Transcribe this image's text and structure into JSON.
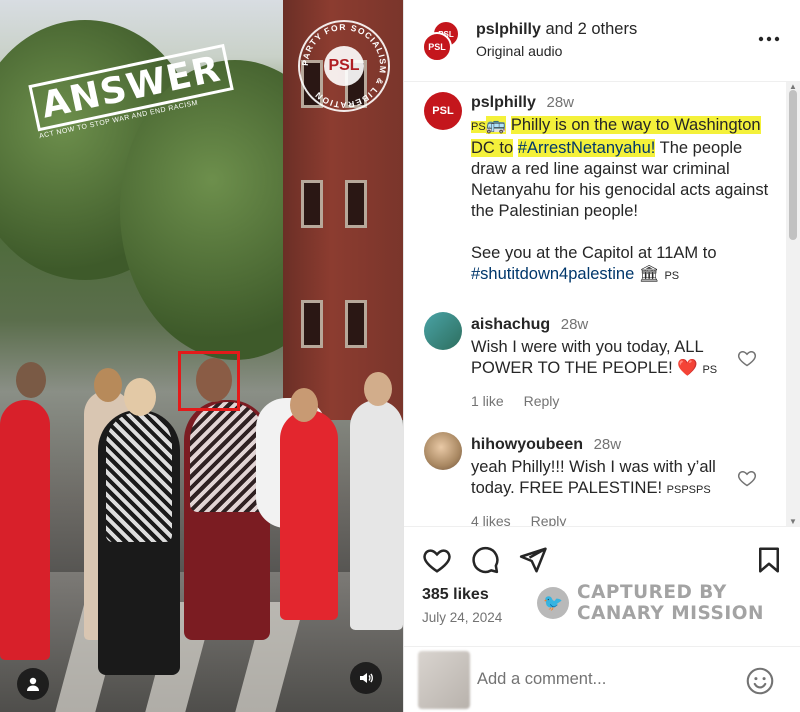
{
  "media": {
    "overlay_logo_text": "ANSWER",
    "overlay_logo_sub": "ACT NOW TO STOP WAR AND END RACISM",
    "seal_center": "PSL",
    "seal_ring": "PARTY FOR SOCIALISM & LIBERATION"
  },
  "header": {
    "account": "pslphilly",
    "others": "and 2 others",
    "audio": "Original audio",
    "more_icon": "more-horizontal-icon"
  },
  "caption": {
    "username": "pslphilly",
    "age": "28w",
    "prefix": "PS",
    "highlighted": "Philly is on the way to Washington DC to",
    "hashtag1": "#ArrestNetanyahu!",
    "rest": " The people draw a red line against war criminal Netanyahu for his genocidal acts against the Palestinian people!",
    "para2": "See you at the Capitol at 11AM to",
    "hashtag2": "#shutitdown4palestine",
    "suffix": "PS"
  },
  "comments": [
    {
      "username": "aishachug",
      "age": "28w",
      "text": "Wish I were with you today, ALL POWER TO THE PEOPLE!",
      "suffix": "PS",
      "likes": "1 like",
      "reply": "Reply"
    },
    {
      "username": "hihowyoubeen",
      "age": "28w",
      "text": "yeah Philly!!! Wish I was with y’all today. FREE PALESTINE!",
      "suffix": "PSPSPS",
      "likes": "4 likes",
      "reply": "Reply"
    }
  ],
  "post": {
    "likes": "385 likes",
    "date": "July 24, 2024"
  },
  "watermark": {
    "line1": "CAPTURED BY",
    "line2": "CANARY MISSION"
  },
  "compose": {
    "placeholder": "Add a comment..."
  },
  "colors": {
    "brand_red": "#c4161c",
    "highlight": "#f4f13a",
    "link": "#00376b",
    "annotation_box": "#e31a1a"
  }
}
